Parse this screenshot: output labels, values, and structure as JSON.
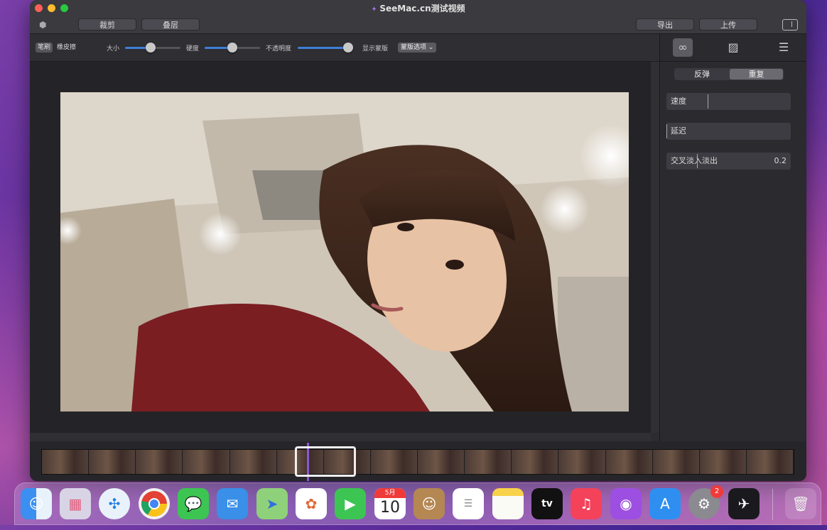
{
  "window": {
    "title": "SeeMac.cn测试视频"
  },
  "toolbar": {
    "crop_label": "裁剪",
    "layer_label": "叠层",
    "export_label": "导出",
    "upload_label": "上传"
  },
  "brush_bar": {
    "brush_label": "笔刷",
    "eraser_label": "橡皮擦",
    "size_label": "大小",
    "size_value": 0.45,
    "hardness_label": "硬度",
    "hardness_value": 0.5,
    "opacity_label": "不透明度",
    "opacity_value": 0.92,
    "show_mask_label": "显示蒙版",
    "mask_options_label": "蒙版选项"
  },
  "right_panel": {
    "bounce_label": "反弹",
    "repeat_label": "重复",
    "speed_label": "速度",
    "delay_label": "延迟",
    "crossfade_label": "交叉淡入淡出",
    "crossfade_value": "0.2"
  },
  "dock": {
    "calendar_month": "5月",
    "calendar_day": "10",
    "appletv_label": "tv",
    "settings_badge": "2"
  },
  "colors": {
    "accent": "#3d7fd8",
    "selection": "#8a5ad0"
  }
}
